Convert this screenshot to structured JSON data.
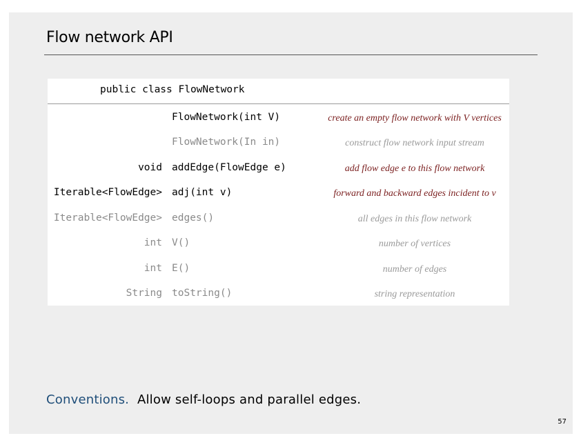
{
  "slide": {
    "title": "Flow network API",
    "page_number": "57"
  },
  "api": {
    "header": "public class FlowNetwork",
    "rows": [
      {
        "ret": "",
        "sig": "FlowNetwork(int V)",
        "desc": "create an empty flow network with V vertices",
        "dimmed": false
      },
      {
        "ret": "",
        "sig": "FlowNetwork(In in)",
        "desc": "construct flow network input stream",
        "dimmed": true
      },
      {
        "ret": "void",
        "sig": "addEdge(FlowEdge e)",
        "desc": "add flow edge e to this flow network",
        "dimmed": false
      },
      {
        "ret": "Iterable<FlowEdge>",
        "sig": "adj(int v)",
        "desc": "forward and backward edges incident to v",
        "dimmed": false
      },
      {
        "ret": "Iterable<FlowEdge>",
        "sig": "edges()",
        "desc": "all edges in this flow network",
        "dimmed": true
      },
      {
        "ret": "int",
        "sig": "V()",
        "desc": "number of vertices",
        "dimmed": true
      },
      {
        "ret": "int",
        "sig": "E()",
        "desc": "number of edges",
        "dimmed": true
      },
      {
        "ret": "String",
        "sig": "toString()",
        "desc": "string representation",
        "dimmed": true
      }
    ]
  },
  "conventions": {
    "label": "Conventions.",
    "text": "Allow self-loops and parallel edges."
  },
  "colors": {
    "slide_background": "#eeeeee",
    "active_description": "#7a1e1e",
    "dimmed_text": "#8a8a8a",
    "conventions_label": "#1f4e79"
  }
}
